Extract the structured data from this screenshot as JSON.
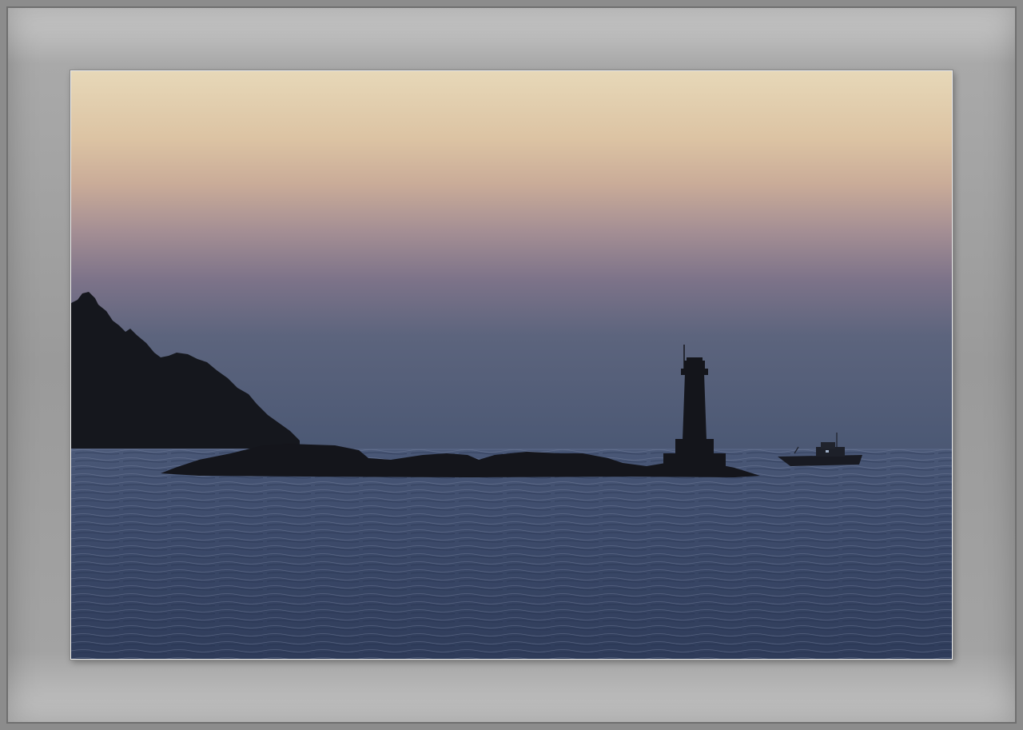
{
  "scene": {
    "description_type": "framed-photograph",
    "elements": [
      "sky",
      "wooded-headland",
      "rocky-islet",
      "lighthouse",
      "fishing-boat",
      "sea"
    ]
  },
  "colors": {
    "frame_light": "#cfcfcf",
    "frame_dark": "#8c8c8c",
    "sky_top": "#e6d6b6",
    "sky_mid": "#b9a3a3",
    "sky_low": "#4c5a78",
    "sea": "#3b4a69",
    "silhouette": "#15161c"
  }
}
